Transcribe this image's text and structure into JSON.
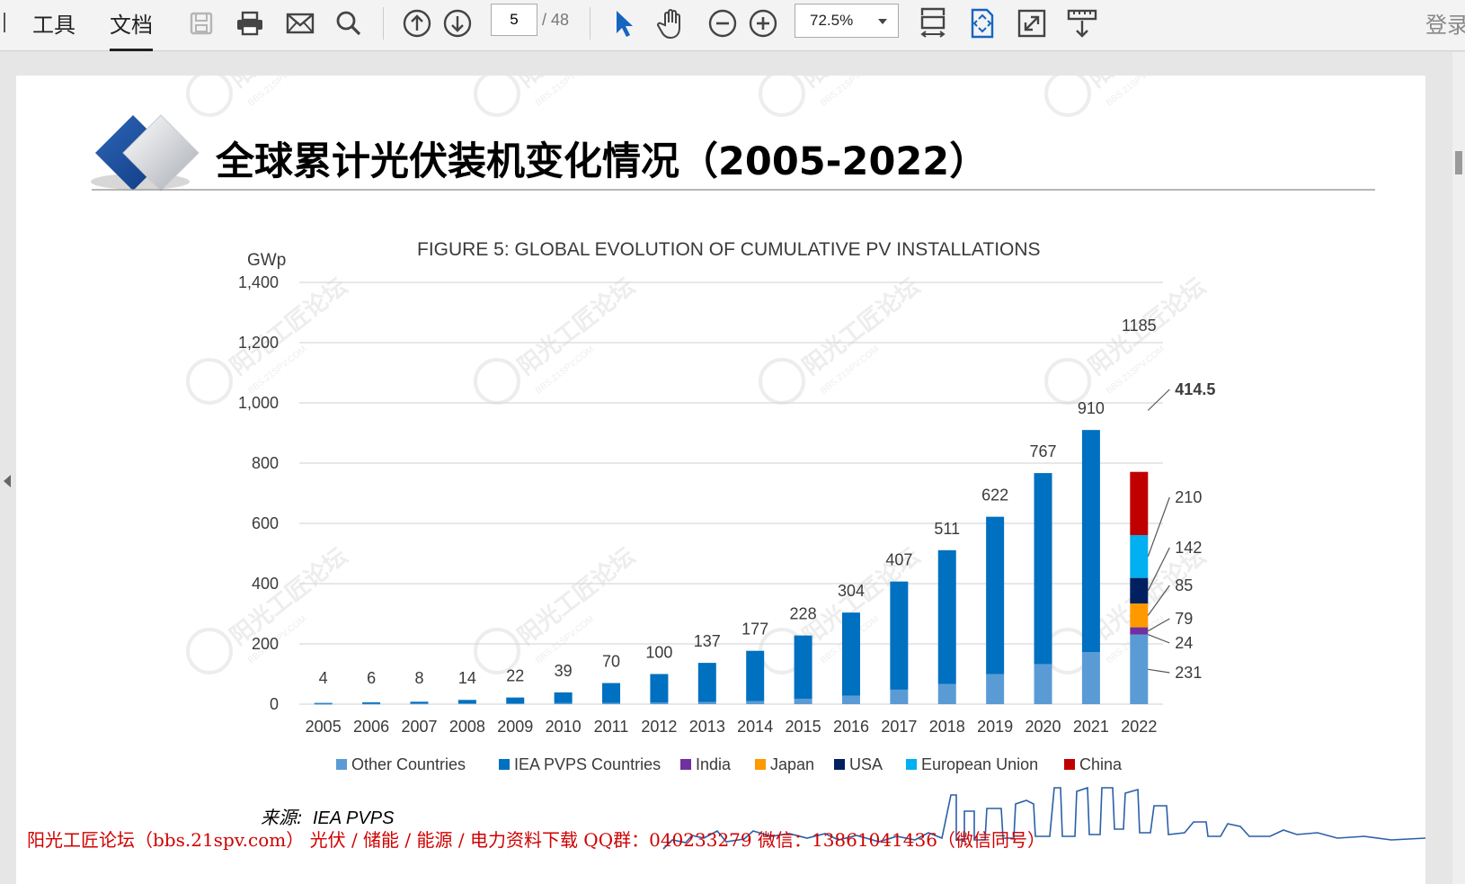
{
  "toolbar": {
    "menu_tools": "工具",
    "menu_document": "文档",
    "page_current": "5",
    "page_total": "/ 48",
    "zoom": "72.5%",
    "login": "登录"
  },
  "slide": {
    "title": "全球累计光伏装机变化情况（2005-2022）",
    "source_label": "来源:",
    "source_text": "IEA PVPS",
    "footer_text": "阳光工匠论坛（bbs.21spv.com）   光伏 / 储能 / 能源 / 电力资料下载   QQ群：040233279   微信：13861041436（微信同号）",
    "watermark_text": "阳光工匠论坛",
    "watermark_url": "BBS.21SPV.COM"
  },
  "colors": {
    "other": "#5b9bd5",
    "iea": "#0070c0",
    "india": "#7030a0",
    "japan": "#ff9900",
    "usa": "#002060",
    "eu": "#00b0f0",
    "china": "#c00000",
    "accent_title": "#1f4e9a",
    "footer_red": "#d00000"
  },
  "chart_data": {
    "type": "bar",
    "title": "FIGURE 5: GLOBAL EVOLUTION OF CUMULATIVE PV INSTALLATIONS",
    "ylabel": "GWp",
    "ylim": [
      0,
      1400
    ],
    "yticks": [
      "0",
      "200",
      "400",
      "600",
      "800",
      "1,000",
      "1,200",
      "1,400"
    ],
    "ytick_values": [
      0,
      200,
      400,
      600,
      800,
      1000,
      1200,
      1400
    ],
    "categories": [
      "2005",
      "2006",
      "2007",
      "2008",
      "2009",
      "2010",
      "2011",
      "2012",
      "2013",
      "2014",
      "2015",
      "2016",
      "2017",
      "2018",
      "2019",
      "2020",
      "2021",
      "2022"
    ],
    "totals": [
      4,
      6,
      8,
      14,
      22,
      39,
      70,
      100,
      137,
      177,
      228,
      304,
      407,
      511,
      622,
      767,
      910,
      1185
    ],
    "total_labels": [
      "4",
      "6",
      "8",
      "14",
      "22",
      "39",
      "70",
      "100",
      "137",
      "177",
      "228",
      "304",
      "407",
      "511",
      "622",
      "767",
      "910",
      "1185"
    ],
    "series": [
      {
        "name": "Other Countries",
        "values": [
          1,
          1.5,
          2,
          2.5,
          3,
          3.5,
          4,
          5,
          7,
          10,
          18,
          28,
          48,
          67,
          100,
          133,
          173,
          231
        ]
      },
      {
        "name": "IEA PVPS Countries",
        "values": [
          3,
          4.5,
          6,
          11.5,
          19,
          35.5,
          66,
          95,
          130,
          167,
          210,
          276,
          359,
          444,
          522,
          634,
          737,
          0
        ]
      },
      {
        "name": "India",
        "values": [
          0,
          0,
          0,
          0,
          0,
          0,
          0,
          0,
          0,
          0,
          0,
          0,
          0,
          0,
          0,
          0,
          0,
          24
        ]
      },
      {
        "name": "Japan",
        "values": [
          0,
          0,
          0,
          0,
          0,
          0,
          0,
          0,
          0,
          0,
          0,
          0,
          0,
          0,
          0,
          0,
          0,
          79
        ]
      },
      {
        "name": "USA",
        "values": [
          0,
          0,
          0,
          0,
          0,
          0,
          0,
          0,
          0,
          0,
          0,
          0,
          0,
          0,
          0,
          0,
          0,
          85
        ]
      },
      {
        "name": "European Union",
        "values": [
          0,
          0,
          0,
          0,
          0,
          0,
          0,
          0,
          0,
          0,
          0,
          0,
          0,
          0,
          0,
          0,
          0,
          142
        ]
      },
      {
        "name": "China",
        "values": [
          0,
          0,
          0,
          0,
          0,
          0,
          0,
          0,
          0,
          0,
          0,
          0,
          0,
          0,
          0,
          0,
          0,
          210
        ]
      }
    ],
    "stack_2022_labels": [
      "231",
      "24",
      "79",
      "85",
      "142",
      "210",
      "414.5"
    ],
    "legend": [
      "Other Countries",
      "IEA PVPS Countries",
      "India",
      "Japan",
      "USA",
      "European Union",
      "China"
    ],
    "legend_position": "bottom",
    "grid": true
  }
}
